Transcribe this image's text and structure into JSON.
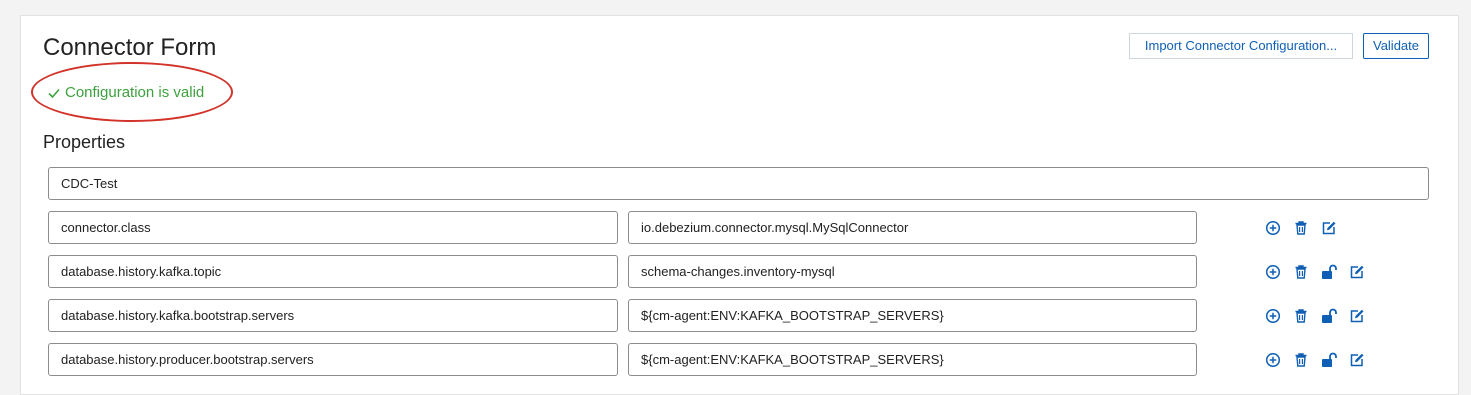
{
  "form": {
    "title": "Connector Form",
    "import_button_label": "Import Connector Configuration...",
    "validate_button_label": "Validate",
    "validation_message": "Configuration is valid",
    "properties_label": "Properties",
    "connector_name": "CDC-Test"
  },
  "properties": [
    {
      "key": "connector.class",
      "value": "io.debezium.connector.mysql.MySqlConnector",
      "lockable": false
    },
    {
      "key": "database.history.kafka.topic",
      "value": "schema-changes.inventory-mysql",
      "lockable": true
    },
    {
      "key": "database.history.kafka.bootstrap.servers",
      "value": "${cm-agent:ENV:KAFKA_BOOTSTRAP_SERVERS}",
      "lockable": true
    },
    {
      "key": "database.history.producer.bootstrap.servers",
      "value": "${cm-agent:ENV:KAFKA_BOOTSTRAP_SERVERS}",
      "lockable": true
    }
  ],
  "icons": {
    "add": "plus-circle-icon",
    "delete": "trash-icon",
    "lock": "unlock-icon",
    "edit": "edit-icon"
  },
  "colors": {
    "accent": "#0f5fb5",
    "valid": "#3da23d",
    "highlight": "#d2332a",
    "field_border": "#8c8c8c"
  }
}
